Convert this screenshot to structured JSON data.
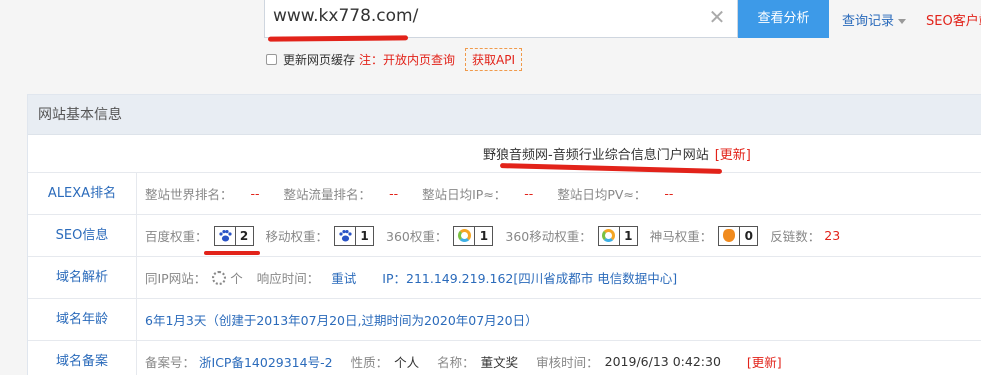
{
  "search": {
    "value": "www.kx778.com/",
    "clear_icon": "close-icon",
    "analyze_label": "查看分析",
    "history_label": "查询记录",
    "seo_client_label": "SEO客户端"
  },
  "cache": {
    "checkbox_label": "更新网页缓存",
    "note": "注：开放内页查询",
    "api_label": "获取API"
  },
  "panel": {
    "heading": "网站基本信息",
    "site_title": "野狼音频网-音频行业综合信息门户网站",
    "site_refresh": "[更新]"
  },
  "alexa": {
    "label": "ALEXA排名",
    "world_rank_key": "整站世界排名：",
    "world_rank_val": "--",
    "traffic_rank_key": "整站流量排名：",
    "traffic_rank_val": "--",
    "daily_ip_key": "整站日均IP≈：",
    "daily_ip_val": "--",
    "daily_pv_key": "整站日均PV≈：",
    "daily_pv_val": "--"
  },
  "seo": {
    "label": "SEO信息",
    "baidu_key": "百度权重：",
    "baidu_val": "2",
    "mobile_key": "移动权重：",
    "mobile_val": "1",
    "w360_key": "360权重：",
    "w360_val": "1",
    "m360_key": "360移动权重：",
    "m360_val": "1",
    "shenma_key": "神马权重：",
    "shenma_val": "0",
    "backlinks_key": "反链数：",
    "backlinks_val": "23"
  },
  "dns": {
    "label": "域名解析",
    "same_ip_key": "同IP网站：",
    "same_ip_unit": "个",
    "response_key": "响应时间：",
    "retry_label": "重试",
    "ip_text": "IP：211.149.219.162[四川省成都市 电信数据中心]"
  },
  "age": {
    "label": "域名年龄",
    "text": "6年1月3天（创建于2013年07月20日,过期时间为2020年07月20日）"
  },
  "icp": {
    "label": "域名备案",
    "number_key": "备案号：",
    "number_val": "浙ICP备14029314号-2",
    "nature_key": "性质：",
    "nature_val": "个人",
    "name_key": "名称：",
    "name_val": "董文奖",
    "audit_key": "审核时间：",
    "audit_val": "2019/6/13 0:42:30",
    "refresh": "[更新]"
  },
  "colors": {
    "accent": "#3d9ae8",
    "link": "#2b6bbb",
    "alert": "#e2231a"
  }
}
